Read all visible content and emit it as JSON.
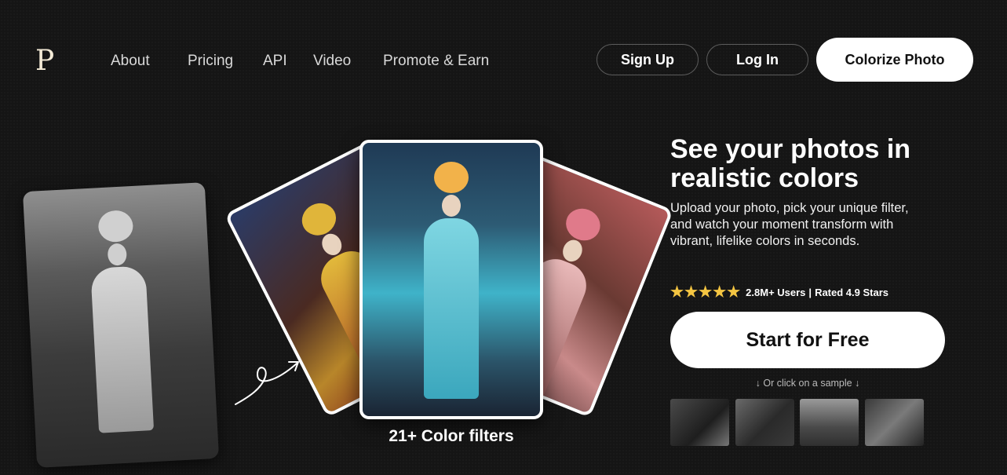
{
  "header": {
    "logo": "P",
    "nav": [
      "About",
      "Pricing",
      "API",
      "Video",
      "Promote & Earn"
    ],
    "sign_up": "Sign Up",
    "log_in": "Log In",
    "colorize": "Colorize Photo"
  },
  "hero": {
    "title": "See your photos in realistic colors",
    "subtitle": "Upload your photo, pick your unique filter, and watch your moment transform with vibrant, lifelike colors in seconds.",
    "stars": "★★★★★",
    "rating_users": "2.8M+ Users",
    "rating_separator": "|",
    "rating_score": "Rated 4.9 Stars",
    "start_button": "Start for Free",
    "sample_hint": "↓ Or click on a sample ↓"
  },
  "showcase": {
    "filters_label": "21+ Color filters"
  },
  "colors": {
    "background": "#151515",
    "star": "#f4c542",
    "button_bg": "#ffffff"
  }
}
